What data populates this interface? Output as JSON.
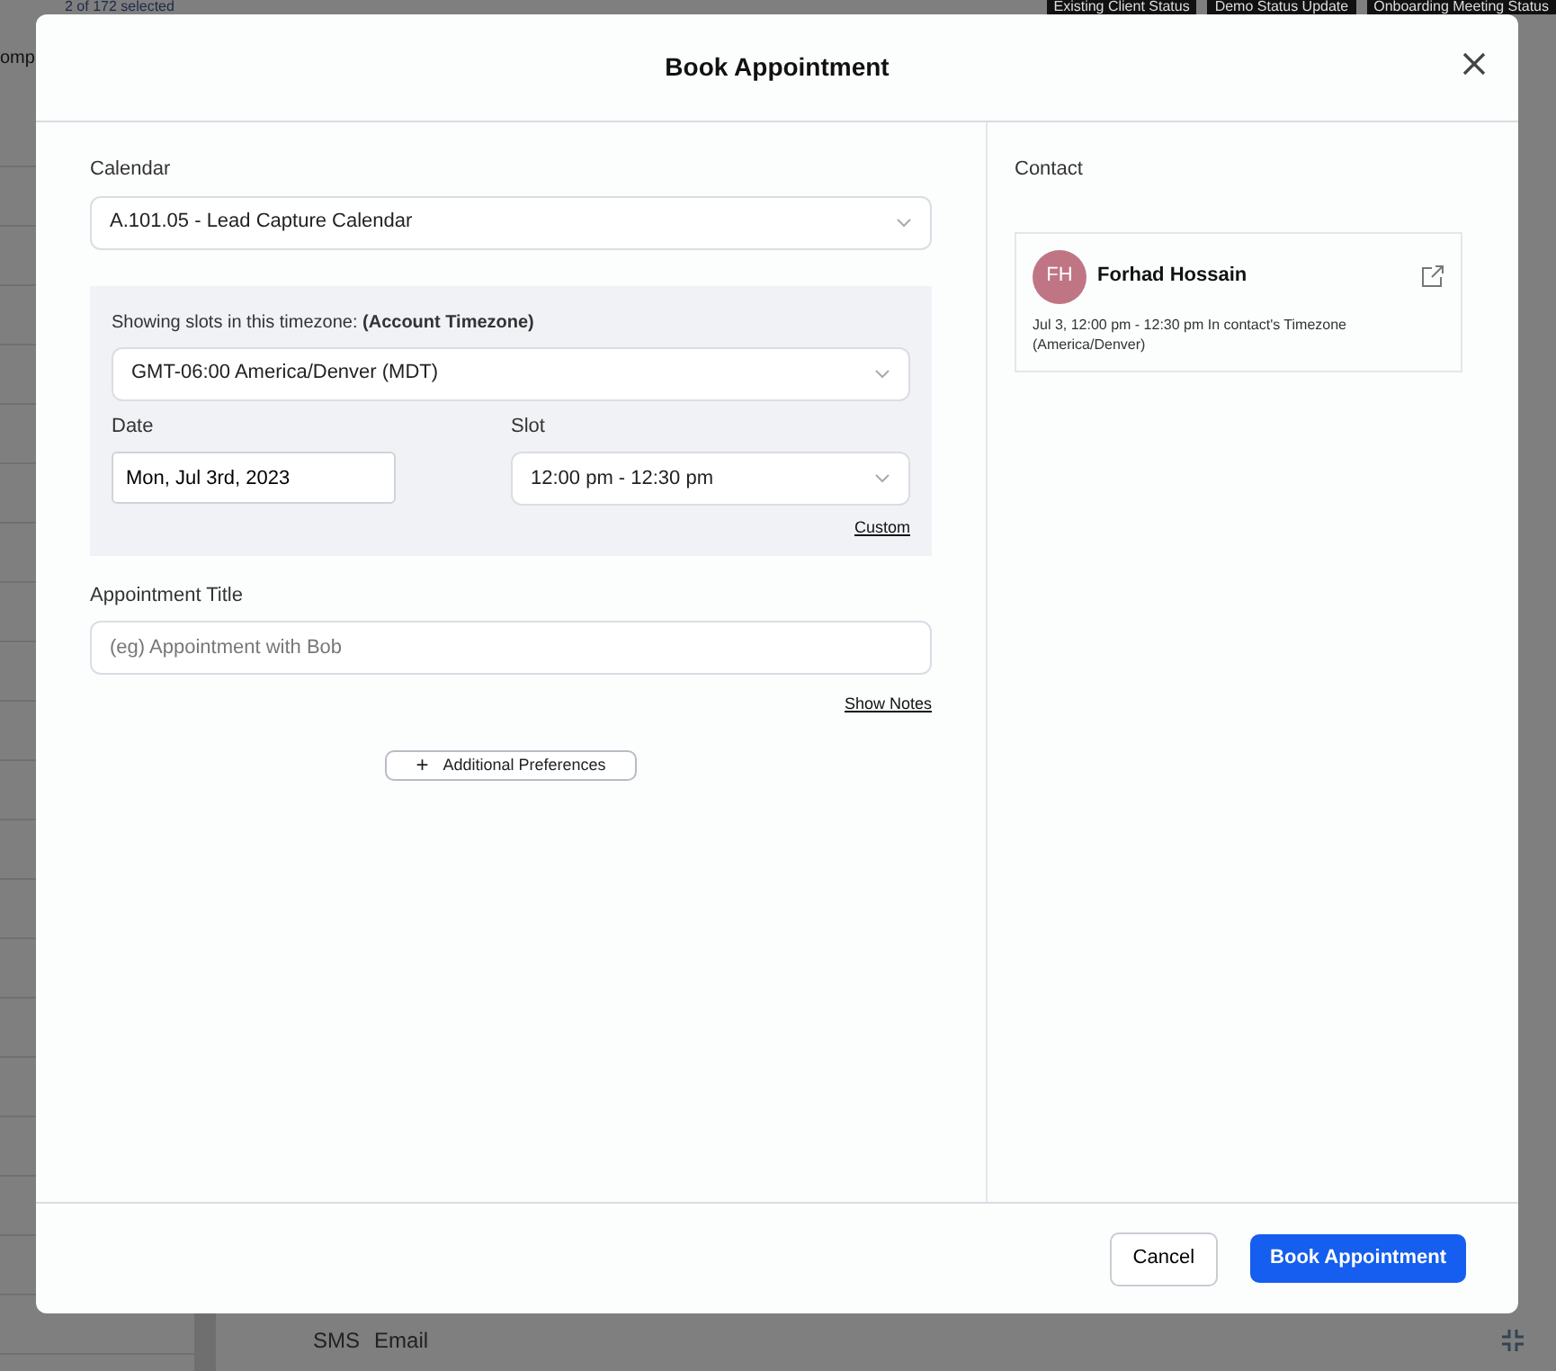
{
  "background": {
    "selection_text": "2 of 172 selected",
    "status_tags": [
      "Existing Client Status",
      "Demo Status Update",
      "Onboarding Meeting Status"
    ],
    "side_text": "omp",
    "message_tabs": [
      "SMS",
      "Email"
    ]
  },
  "modal": {
    "title": "Book Appointment",
    "calendar": {
      "label": "Calendar",
      "value": "A.101.05 - Lead Capture Calendar"
    },
    "timezone": {
      "label": "Showing slots in this timezone: **(Account Timezone)**",
      "value": "GMT-06:00 America/Denver (MDT)"
    },
    "date": {
      "label": "Date",
      "value": "Mon, Jul 3rd, 2023"
    },
    "slot": {
      "label": "Slot",
      "value": "12:00 pm - 12:30 pm"
    },
    "custom_link": "Custom",
    "appointment_title": {
      "label": "Appointment Title",
      "placeholder": "(eg) Appointment with Bob"
    },
    "show_notes_link": "Show Notes",
    "additional_preferences": {
      "icon": "+",
      "label": "Additional Preferences"
    },
    "contact": {
      "label": "Contact",
      "initials": "FH",
      "color": "#c07585",
      "name": "Forhad Hossain",
      "details": "Jul 3, 12:00 pm - 12:30 pm In contact's Timezone (America/Denver)"
    },
    "buttons": {
      "cancel": "Cancel",
      "confirm": "Book Appointment"
    }
  }
}
